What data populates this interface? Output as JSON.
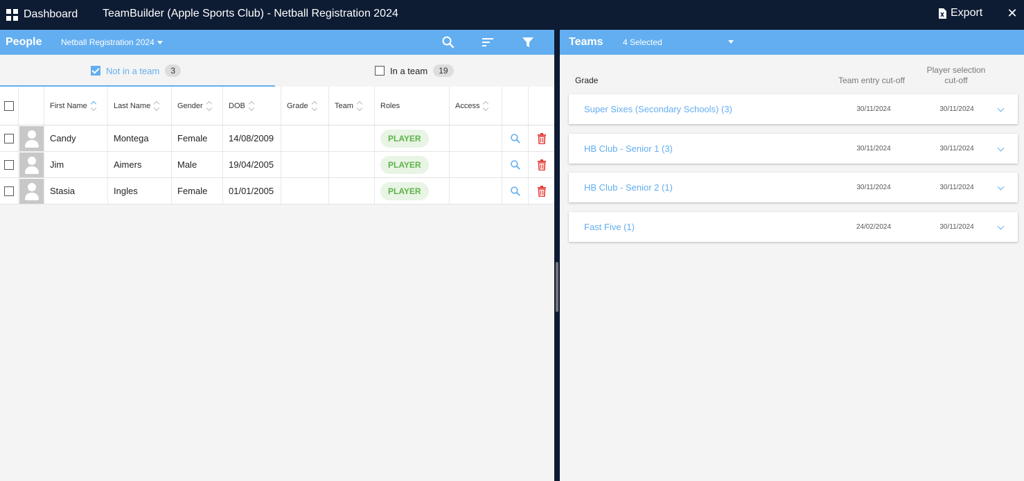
{
  "topbar": {
    "dashboard_label": "Dashboard",
    "title": "TeamBuilder (Apple Sports Club) - Netball Registration 2024",
    "export_label": "Export",
    "close_glyph": "✕"
  },
  "people": {
    "title": "People",
    "registration": "Netball Registration 2024",
    "filters": {
      "not_in_team": {
        "label": "Not in a team",
        "count": "3",
        "checked": true
      },
      "in_team": {
        "label": "In a team",
        "count": "19",
        "checked": false
      }
    },
    "columns": [
      "First Name",
      "Last Name",
      "Gender",
      "DOB",
      "Grade",
      "Team",
      "Roles",
      "Access"
    ],
    "rows": [
      {
        "first": "Candy",
        "last": "Montega",
        "gender": "Female",
        "dob": "14/08/2009",
        "grade": "",
        "team": "",
        "role": "PLAYER",
        "access": ""
      },
      {
        "first": "Jim",
        "last": "Aimers",
        "gender": "Male",
        "dob": "19/04/2005",
        "grade": "",
        "team": "",
        "role": "PLAYER",
        "access": ""
      },
      {
        "first": "Stasia",
        "last": "Ingles",
        "gender": "Female",
        "dob": "01/01/2005",
        "grade": "",
        "team": "",
        "role": "PLAYER",
        "access": ""
      }
    ]
  },
  "teams": {
    "title": "Teams",
    "selected_label": "4 Selected",
    "grade_header": "Grade",
    "entry_header": "Team entry cut-off",
    "player_header_line1": "Player selection",
    "player_header_line2": "cut-off",
    "items": [
      {
        "name": "Super Sixes (Secondary Schools) (3)",
        "entry": "30/11/2024",
        "player": "30/11/2024"
      },
      {
        "name": "HB Club - Senior 1 (3)",
        "entry": "30/11/2024",
        "player": "30/11/2024"
      },
      {
        "name": "HB Club - Senior 2 (1)",
        "entry": "30/11/2024",
        "player": "30/11/2024"
      },
      {
        "name": "Fast Five (1)",
        "entry": "24/02/2024",
        "player": "30/11/2024"
      }
    ]
  },
  "colors": {
    "accent": "#63aef0",
    "dark": "#0d1b33",
    "player_green": "#5db34a",
    "delete_red": "#e53935"
  }
}
